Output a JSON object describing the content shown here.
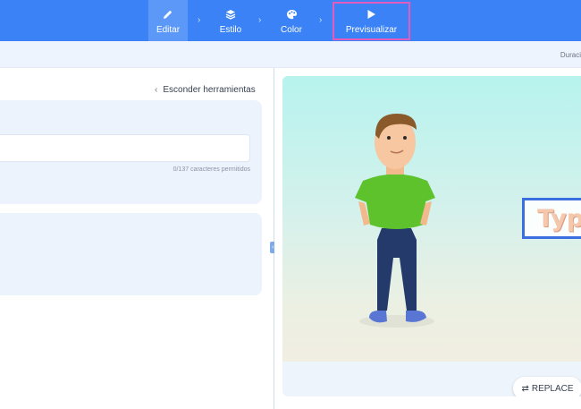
{
  "steps": {
    "editar": "Editar",
    "estilo": "Estilo",
    "color": "Color",
    "previsualizar": "Previsualizar",
    "separator": "›"
  },
  "subbar": {
    "duracion": "Duraci"
  },
  "editor": {
    "hide_tools": "Esconder herramientas",
    "hide_tools_icon": "‹",
    "text_input_value": "",
    "char_count": "0/137 caracteres permitidos"
  },
  "handle": {
    "icon": "‹›"
  },
  "preview": {
    "title_text": "Typ",
    "replace_label": "REPLACE",
    "replace_icon": "⇄"
  },
  "colors": {
    "accent": "#3b82f6",
    "active_step": "#5b98f7",
    "highlight": "#e25bbd",
    "panel": "#edf3fd"
  }
}
